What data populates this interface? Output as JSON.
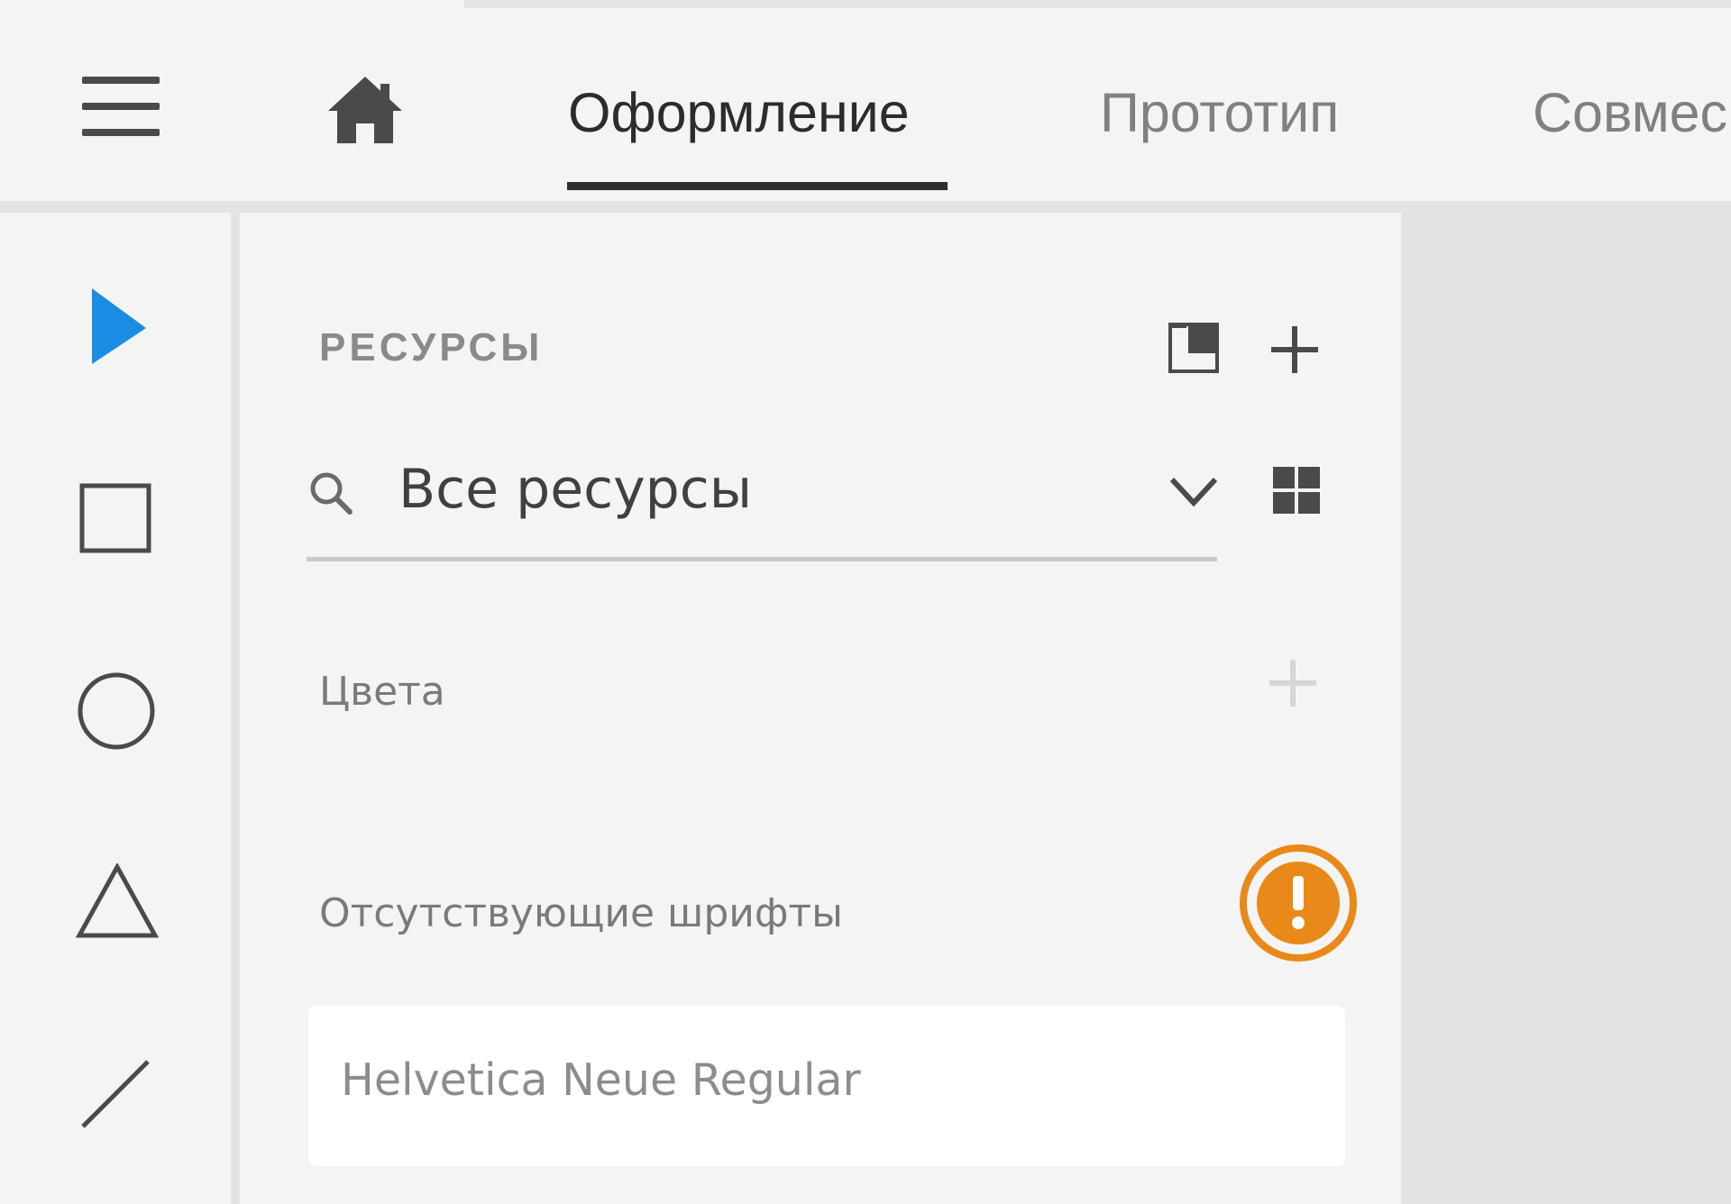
{
  "header": {
    "menu_icon": "hamburger-icon",
    "home_icon": "home-icon",
    "tabs": [
      {
        "label": "Оформление",
        "active": true
      },
      {
        "label": "Прототип",
        "active": false
      },
      {
        "label": "Совмес",
        "active": false
      }
    ]
  },
  "toolbar": {
    "tools": [
      {
        "name": "select-tool",
        "icon": "cursor-arrow-icon",
        "active": true
      },
      {
        "name": "rectangle-tool",
        "icon": "rectangle-icon",
        "active": false
      },
      {
        "name": "ellipse-tool",
        "icon": "circle-icon",
        "active": false
      },
      {
        "name": "polygon-tool",
        "icon": "triangle-icon",
        "active": false
      },
      {
        "name": "line-tool",
        "icon": "line-icon",
        "active": false
      }
    ]
  },
  "assets_panel": {
    "title": "РЕСУРСЫ",
    "filter": {
      "search_icon": "search-icon",
      "selected": "Все ресурсы",
      "dropdown_icon": "chevron-down-icon",
      "view_icon": "grid-view-icon"
    },
    "colors_section": {
      "label": "Цвета"
    },
    "missing_fonts_section": {
      "label": "Отсутствующие шрифты",
      "warning_icon": "exclamation-warning-icon",
      "fonts": [
        "Helvetica Neue Regular"
      ]
    }
  },
  "colors": {
    "accent": "#1b8ce3",
    "warning": "#e8891a",
    "active_text": "#2c2c2c",
    "inactive_text": "#808080"
  }
}
